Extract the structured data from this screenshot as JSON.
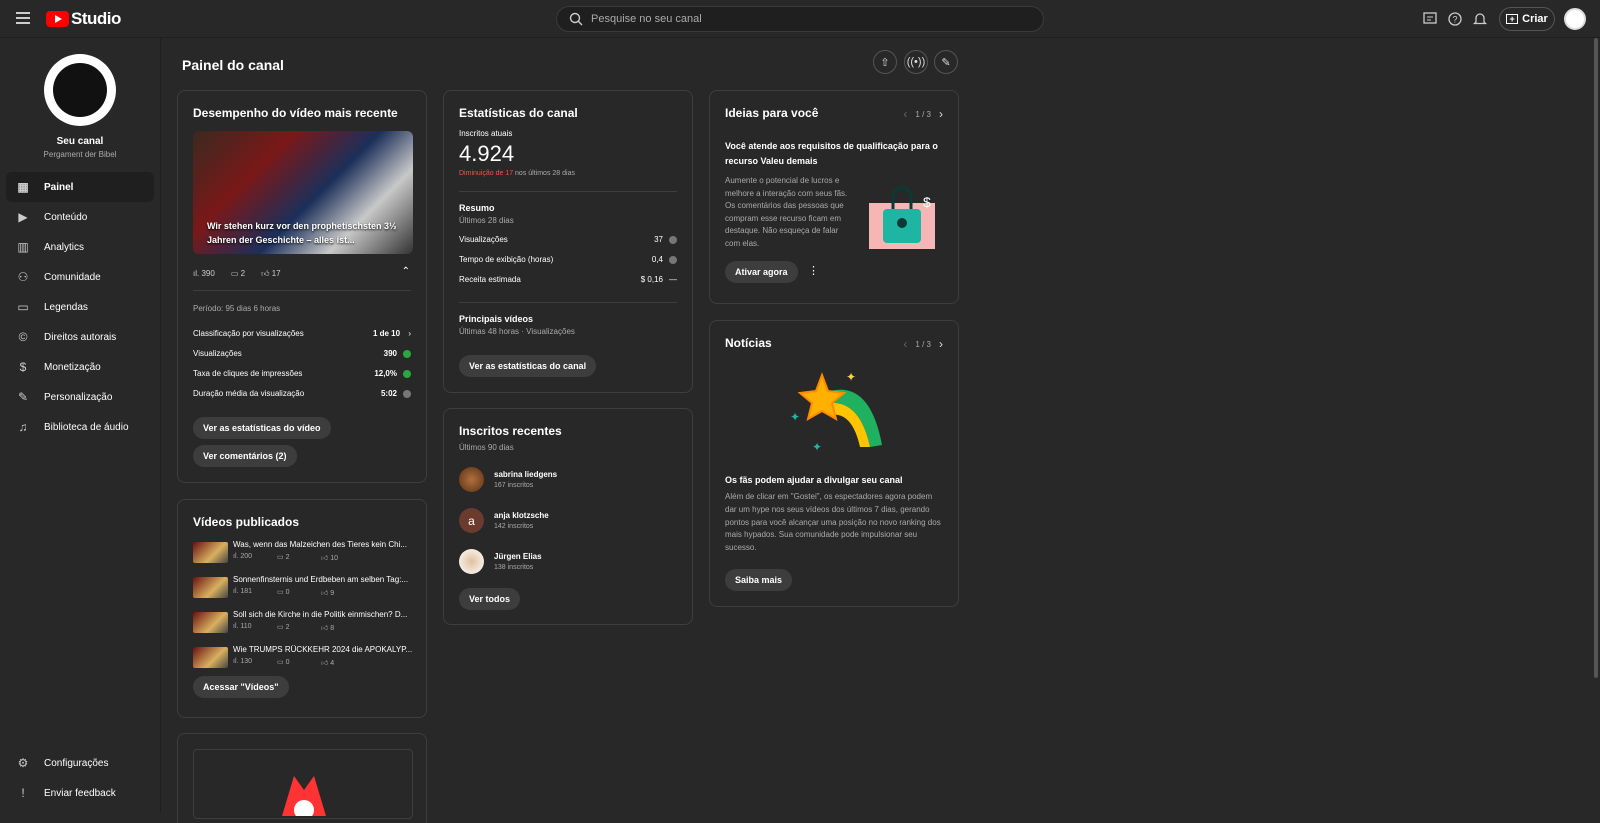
{
  "topbar": {
    "logo_text": "Studio",
    "search_placeholder": "Pesquise no seu canal",
    "create_label": "Criar"
  },
  "channel": {
    "name": "Seu canal",
    "subtitle": "Pergament der Bibel"
  },
  "nav": [
    {
      "label": "Painel",
      "icon": "dashboard-icon",
      "glyph": "▦"
    },
    {
      "label": "Conteúdo",
      "icon": "content-icon",
      "glyph": "▶"
    },
    {
      "label": "Analytics",
      "icon": "analytics-icon",
      "glyph": "▥"
    },
    {
      "label": "Comunidade",
      "icon": "community-icon",
      "glyph": "⚇"
    },
    {
      "label": "Legendas",
      "icon": "subtitles-icon",
      "glyph": "▭"
    },
    {
      "label": "Direitos autorais",
      "icon": "copyright-icon",
      "glyph": "©"
    },
    {
      "label": "Monetização",
      "icon": "dollar-icon",
      "glyph": "$"
    },
    {
      "label": "Personalização",
      "icon": "magic-wand-icon",
      "glyph": "✎"
    },
    {
      "label": "Biblioteca de áudio",
      "icon": "audio-library-icon",
      "glyph": "♫"
    }
  ],
  "nav_bottom": [
    {
      "label": "Configurações",
      "glyph": "⚙"
    },
    {
      "label": "Enviar feedback",
      "glyph": "!"
    }
  ],
  "page_title": "Painel do canal",
  "recent_video": {
    "title": "Desempenho do vídeo mais recente",
    "thumb_caption": "Wir stehen kurz vor den prophetischsten 3½ Jahren der Geschichte – alles ist...",
    "views": "390",
    "comments": "2",
    "likes": "17",
    "period": "Período: 95 dias 6 horas",
    "rows": [
      {
        "label": "Classificação por visualizações",
        "value": "1 de 10"
      },
      {
        "label": "Visualizações",
        "value": "390"
      },
      {
        "label": "Taxa de cliques de impressões",
        "value": "12,0%"
      },
      {
        "label": "Duração média da visualização",
        "value": "5:02"
      }
    ],
    "btn_stats": "Ver as estatísticas do vídeo",
    "btn_comments": "Ver comentários (2)"
  },
  "published": {
    "title": "Vídeos publicados",
    "videos": [
      {
        "title": "Was, wenn das Malzeichen des Tieres kein Chi...",
        "views": "200",
        "comments": "2",
        "likes": "10"
      },
      {
        "title": "Sonnenfinsternis und Erdbeben am selben Tag:...",
        "views": "181",
        "comments": "0",
        "likes": "9"
      },
      {
        "title": "Soll sich die Kirche in die Politik einmischen? D...",
        "views": "110",
        "comments": "2",
        "likes": "8"
      },
      {
        "title": "Wie TRUMPS RÜCKKEHR 2024 die APOKALYP...",
        "views": "130",
        "comments": "0",
        "likes": "4"
      }
    ],
    "btn": "Acessar \"Vídeos\""
  },
  "stats": {
    "title": "Estatísticas do canal",
    "subs_label": "Inscritos atuais",
    "subs_value": "4.924",
    "change_red": "Diminuição de 17",
    "change_rest": " nos últimos 28 dias",
    "summary_title": "Resumo",
    "summary_sub": "Últimos 28 dias",
    "rows": [
      {
        "label": "Visualizações",
        "value": "37"
      },
      {
        "label": "Tempo de exibição (horas)",
        "value": "0,4"
      },
      {
        "label": "Receita estimada",
        "value": "$ 0,16"
      }
    ],
    "top_title": "Principais vídeos",
    "top_sub": "Últimas 48 horas · Visualizações",
    "btn": "Ver as estatísticas do canal"
  },
  "recent_subs": {
    "title": "Inscritos recentes",
    "sub": "Últimos 90 dias",
    "items": [
      {
        "name": "sabrina liedgens",
        "count": "167 inscritos",
        "initial": ""
      },
      {
        "name": "anja klotzsche",
        "count": "142 inscritos",
        "initial": "a"
      },
      {
        "name": "Jürgen Elias",
        "count": "138 inscritos",
        "initial": ""
      }
    ],
    "btn": "Ver todos"
  },
  "ideas": {
    "title": "Ideias para você",
    "pager": "1 / 3",
    "heading": "Você atende aos requisitos de qualificação para o recurso Valeu demais",
    "body": "Aumente o potencial de lucros e melhore a interação com seus fãs. Os comentários das pessoas que compram esse recurso ficam em destaque. Não esqueça de falar com elas.",
    "btn": "Ativar agora"
  },
  "news": {
    "title": "Notícias",
    "pager": "1 / 3",
    "heading": "Os fãs podem ajudar a divulgar seu canal",
    "body": "Além de clicar em \"Gostei\", os espectadores agora podem dar um hype nos seus vídeos dos últimos 7 dias, gerando pontos para você alcançar uma posição no novo ranking dos mais hypados. Sua comunidade pode impulsionar seu sucesso.",
    "btn": "Saiba mais"
  },
  "colors": {
    "accent_red": "#ff0000",
    "decrease_red": "#ff4e45",
    "good_green": "#2ba640"
  }
}
